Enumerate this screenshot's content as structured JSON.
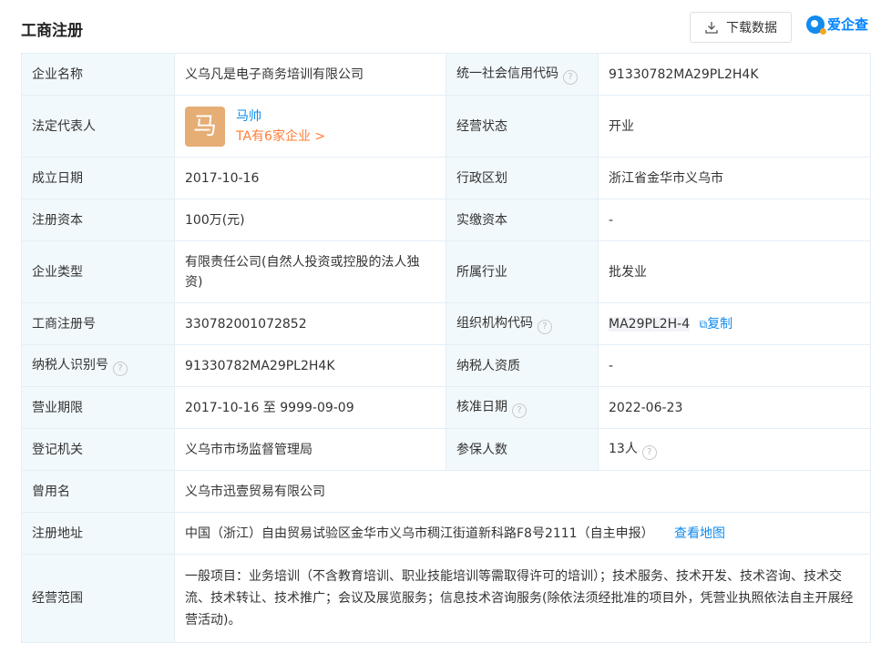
{
  "header": {
    "title": "工商注册",
    "download_label": "下载数据",
    "logo_text": "爱企查"
  },
  "info": {
    "company_name_label": "企业名称",
    "company_name": "义乌凡是电子商务培训有限公司",
    "credit_code_label": "统一社会信用代码",
    "credit_code": "91330782MA29PL2H4K",
    "legal_rep_label": "法定代表人",
    "legal_rep_avatar": "马",
    "legal_rep_name": "马帅",
    "legal_rep_companies": "TA有6家企业 >",
    "status_label": "经营状态",
    "status": "开业",
    "established_label": "成立日期",
    "established": "2017-10-16",
    "region_label": "行政区划",
    "region": "浙江省金华市义乌市",
    "reg_capital_label": "注册资本",
    "reg_capital": "100万(元)",
    "paid_capital_label": "实缴资本",
    "paid_capital": "-",
    "company_type_label": "企业类型",
    "company_type": "有限责任公司(自然人投资或控股的法人独资)",
    "industry_label": "所属行业",
    "industry": "批发业",
    "reg_no_label": "工商注册号",
    "reg_no": "330782001072852",
    "org_code_label": "组织机构代码",
    "org_code": "MA29PL2H-4",
    "copy_label": "复制",
    "taxpayer_id_label": "纳税人识别号",
    "taxpayer_id": "91330782MA29PL2H4K",
    "taxpayer_qual_label": "纳税人资质",
    "taxpayer_qual": "-",
    "term_label": "营业期限",
    "term": "2017-10-16 至 9999-09-09",
    "approval_date_label": "核准日期",
    "approval_date": "2022-06-23",
    "authority_label": "登记机关",
    "authority": "义乌市市场监督管理局",
    "insured_label": "参保人数",
    "insured": "13人",
    "former_name_label": "曾用名",
    "former_name": "义乌市迅壹贸易有限公司",
    "address_label": "注册地址",
    "address": "中国（浙江）自由贸易试验区金华市义乌市稠江街道新科路F8号2111（自主申报）",
    "map_link": "查看地图",
    "scope_label": "经营范围",
    "scope": "一般项目：业务培训（不含教育培训、职业技能培训等需取得许可的培训）；技术服务、技术开发、技术咨询、技术交流、技术转让、技术推广；会议及展览服务；信息技术咨询服务(除依法须经批准的项目外，凭营业执照依法自主开展经营活动)。"
  },
  "icons": {
    "download": "download-icon",
    "help": "question-circle-icon",
    "copy": "copy-icon"
  },
  "colors": {
    "label_bg": "#f2f9fc",
    "border": "#e4eef6",
    "link": "#128bed",
    "accent_orange": "#ff7d36",
    "avatar_bg": "#e6ad74"
  }
}
